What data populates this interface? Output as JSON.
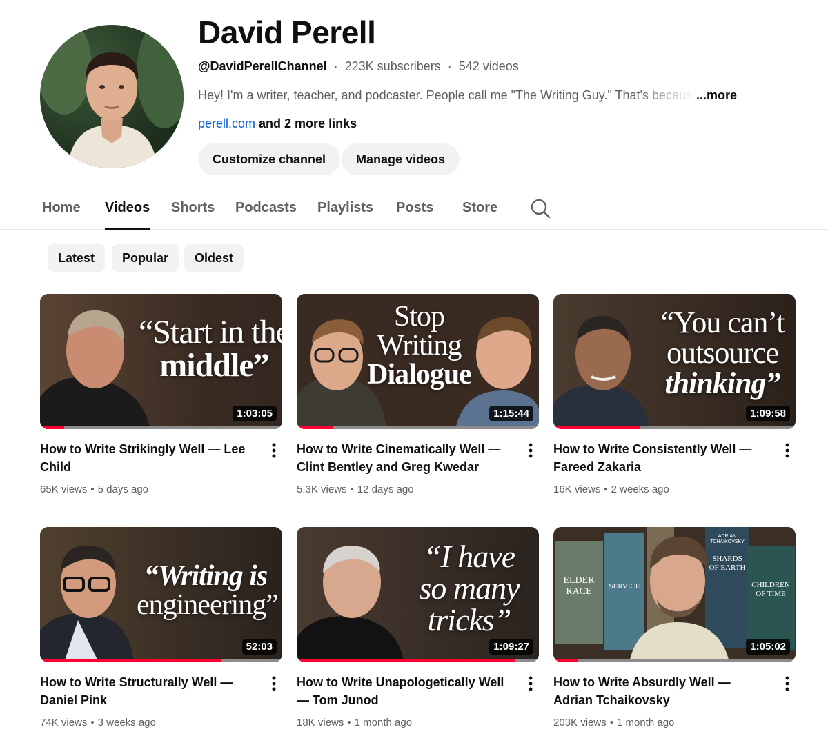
{
  "channel": {
    "name": "David Perell",
    "handle": "@DavidPerellChannel",
    "subscribers": "223K subscribers",
    "videos_count": "542 videos",
    "separator": "·",
    "description": "Hey! I'm a writer, teacher, and podcaster. People call me \"The Writing Guy.\" That's because",
    "description_more": "...more",
    "link": "perell.com",
    "more_links": "and 2 more links"
  },
  "actions": {
    "customize": "Customize channel",
    "manage": "Manage videos"
  },
  "tabs": [
    "Home",
    "Videos",
    "Shorts",
    "Podcasts",
    "Playlists",
    "Posts",
    "Store"
  ],
  "active_tab": "Videos",
  "chips": [
    "Latest",
    "Popular",
    "Oldest"
  ],
  "videos": [
    {
      "title": "How to Write Strikingly Well — Lee Child",
      "views": "65K views",
      "age": "5 days ago",
      "duration": "1:03:05",
      "thumb_text": [
        "“Start in the",
        "middle”"
      ],
      "watched": 0.1
    },
    {
      "title": "How to Write Cinematically Well — Clint Bentley and Greg Kwedar",
      "views": "5.3K views",
      "age": "12 days ago",
      "duration": "1:15:44",
      "thumb_text": [
        "Stop",
        "Writing",
        "Dialogue"
      ],
      "watched": 0.15
    },
    {
      "title": "How to Write Consistently Well — Fareed Zakaria",
      "views": "16K views",
      "age": "2 weeks ago",
      "duration": "1:09:58",
      "thumb_text": [
        "“You can’t",
        "outsource",
        "thinking”"
      ],
      "watched": 0.36
    },
    {
      "title": "How to Write Structurally Well — Daniel Pink",
      "views": "74K views",
      "age": "3 weeks ago",
      "duration": "52:03",
      "thumb_text": [
        "“Writing is",
        "engineering”"
      ],
      "watched": 0.75
    },
    {
      "title": "How to Write Unapologetically Well — Tom Junod",
      "views": "18K views",
      "age": "1 month ago",
      "duration": "1:09:27",
      "thumb_text": [
        "“I have",
        "so many",
        "tricks”"
      ],
      "watched": 0.9
    },
    {
      "title": "How to Write Absurdly Well — Adrian Tchaikovsky",
      "views": "203K views",
      "age": "1 month ago",
      "duration": "1:05:02",
      "thumb_text": [
        "ELDER RACE",
        "SERVICE",
        "SHARDS OF EARTH",
        "CHILDREN OF TIME",
        "ADRIAN TCHAIKOVSKY"
      ],
      "watched": 0.1
    }
  ],
  "colors": {
    "accent_red": "#ff0033",
    "link_blue": "#065fd4",
    "chip_bg": "#f2f2f2"
  }
}
